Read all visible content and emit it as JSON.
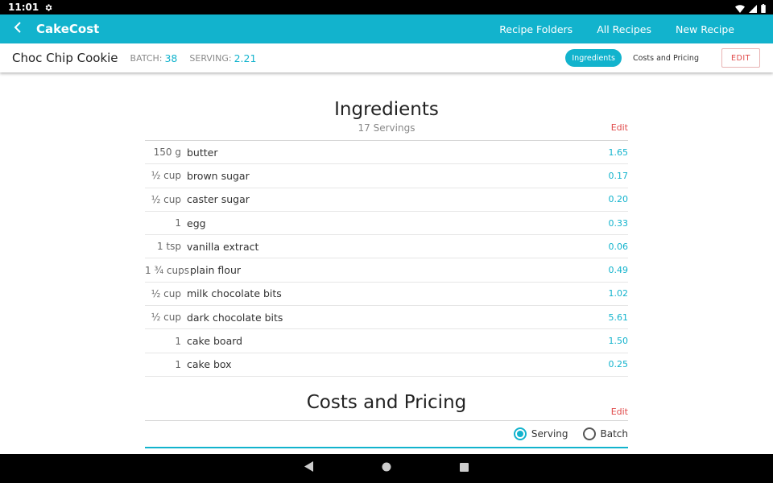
{
  "status_bar": {
    "time": "11:01"
  },
  "app_bar": {
    "title": "CakeCost",
    "nav": [
      "Recipe Folders",
      "All Recipes",
      "New Recipe"
    ]
  },
  "recipe": {
    "name": "Choc Chip Cookie",
    "batch_label": "BATCH:",
    "batch_value": "38",
    "serving_label": "SERVING:",
    "serving_value": "2.21",
    "tabs": [
      "Ingredients",
      "Costs and Pricing"
    ],
    "edit_label": "EDIT"
  },
  "ingredients": {
    "title": "Ingredients",
    "servings": "17 Servings",
    "edit_label": "Edit",
    "items": [
      {
        "qty": "150 g",
        "name": "butter",
        "cost": "1.65"
      },
      {
        "qty": "½ cup",
        "name": "brown sugar",
        "cost": "0.17"
      },
      {
        "qty": "½ cup",
        "name": "caster sugar",
        "cost": "0.20"
      },
      {
        "qty": "1",
        "name": "egg",
        "cost": "0.33"
      },
      {
        "qty": "1 tsp",
        "name": "vanilla extract",
        "cost": "0.06"
      },
      {
        "qty": "1 ¾ cups",
        "name": "plain flour",
        "cost": "0.49"
      },
      {
        "qty": "½ cup",
        "name": "milk chocolate bits",
        "cost": "1.02"
      },
      {
        "qty": "½ cup",
        "name": "dark chocolate bits",
        "cost": "5.61"
      },
      {
        "qty": "1",
        "name": "cake board",
        "cost": "1.50"
      },
      {
        "qty": "1",
        "name": "cake box",
        "cost": "0.25"
      }
    ]
  },
  "costs": {
    "title": "Costs and Pricing",
    "edit_label": "Edit",
    "options": [
      "Serving",
      "Batch"
    ],
    "selected": "Serving"
  },
  "colors": {
    "accent": "#12b3cd",
    "edit_red": "#e04a4a"
  }
}
